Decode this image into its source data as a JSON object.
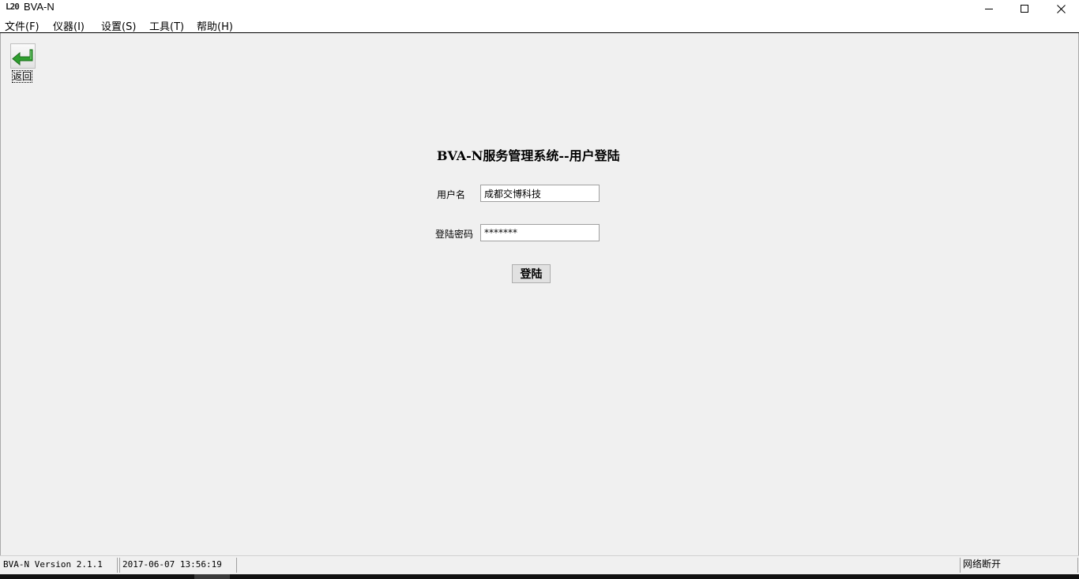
{
  "window": {
    "icon_text": "L20",
    "title": "BVA-N"
  },
  "menu": {
    "items": [
      {
        "label": "文件(F)"
      },
      {
        "label": "仪器(I)"
      },
      {
        "label": "设置(S)"
      },
      {
        "label": "工具(T)"
      },
      {
        "label": "帮助(H)"
      }
    ]
  },
  "toolbar": {
    "back_label": "返回",
    "back_icon": "return-arrow-icon"
  },
  "login": {
    "title": "BVA-N服务管理系统--用户登陆",
    "username_label": "用户名",
    "username_value": "成都交博科技",
    "password_label": "登陆密码",
    "password_value": "*******",
    "submit_label": "登陆"
  },
  "status": {
    "version": "BVA-N Version 2.1.1",
    "datetime": "2017-06-07 13:56:19",
    "network": "网络断开"
  },
  "colors": {
    "background": "#f0f0f0",
    "arrow_green": "#2e9e2e"
  }
}
